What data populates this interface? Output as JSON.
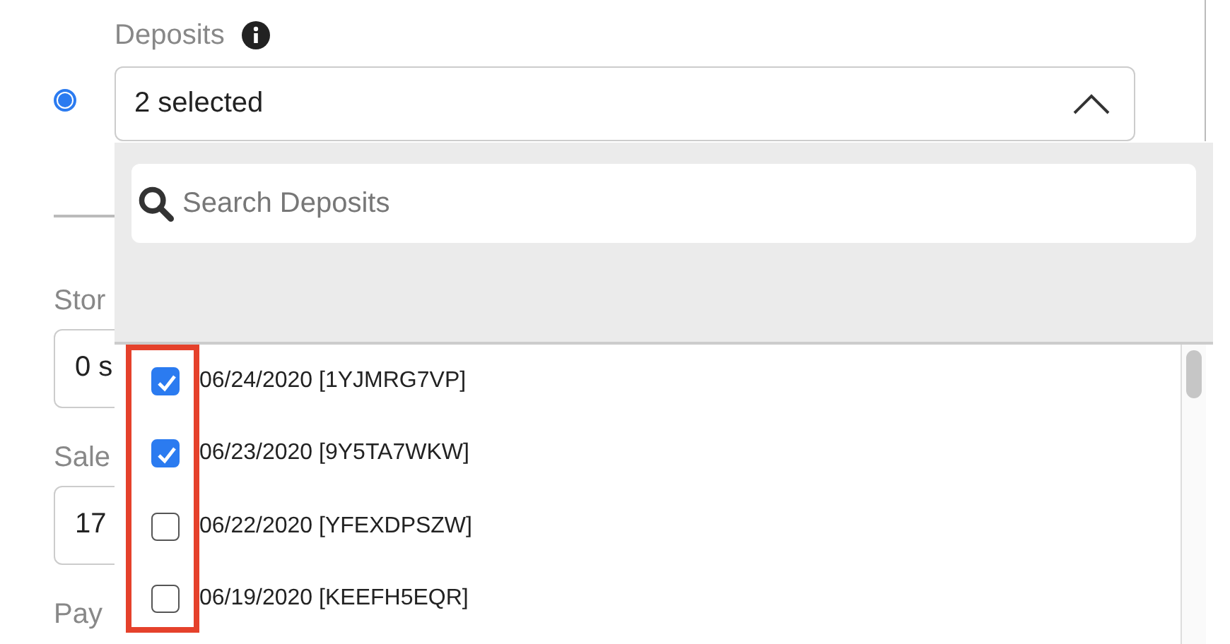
{
  "deposits": {
    "selected": true,
    "label": "Deposits",
    "value": "2 selected",
    "expanded": true,
    "search": {
      "placeholder": "Search Deposits"
    },
    "checkboxes_highlighted": true,
    "options": [
      {
        "label": "06/24/2020 [1YJMRG7VP]",
        "checked": true
      },
      {
        "label": "06/23/2020 [9Y5TA7WKW]",
        "checked": true
      },
      {
        "label": "06/22/2020 [YFEXDPSZW]",
        "checked": false
      },
      {
        "label": "06/19/2020 [KEEFH5EQR]",
        "checked": false
      }
    ]
  },
  "fields": [
    {
      "label": "Stor",
      "value": "0 s"
    },
    {
      "label": "Sale",
      "value": "17"
    },
    {
      "label": "Pay"
    }
  ]
}
